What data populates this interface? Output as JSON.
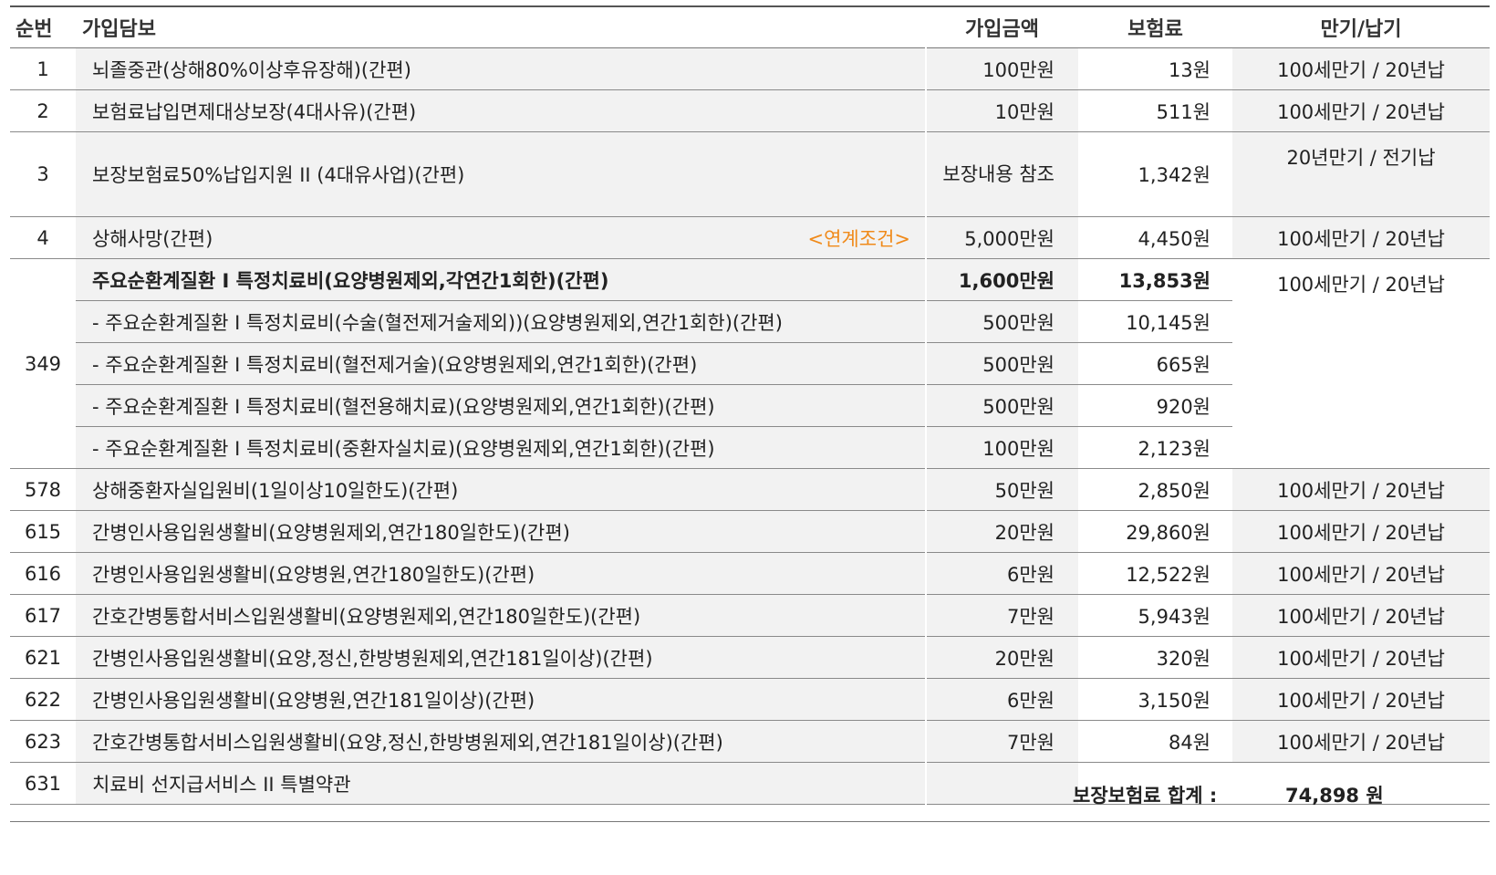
{
  "headers": {
    "no": "순번",
    "name": "가입담보",
    "amount": "가입금액",
    "premium": "보험료",
    "term": "만기/납기"
  },
  "rows": [
    {
      "no": "1",
      "name": "뇌졸중관(상해80%이상후유장해)(간편)",
      "amount": "100만원",
      "premium": "13원",
      "term": "100세만기 / 20년납"
    },
    {
      "no": "2",
      "name": "보험료납입면제대상보장(4대사유)(간편)",
      "amount": "10만원",
      "premium": "511원",
      "term": "100세만기 / 20년납"
    },
    {
      "no": "3",
      "name": "보장보험료50%납입지원 II (4대유사업)(간편)",
      "amount": "보장내용 참조",
      "premium": "1,342원",
      "term": "20년만기 / 전기납"
    },
    {
      "no": "4",
      "name": "상해사망(간편)",
      "link": "<연계조건>",
      "amount": "5,000만원",
      "premium": "4,450원",
      "term": "100세만기 / 20년납"
    }
  ],
  "group": {
    "no": "349",
    "term": "100세만기 / 20년납",
    "main": {
      "name": "주요순환계질환 I  특정치료비(요양병원제외,각연간1회한)(간편)",
      "amount": "1,600만원",
      "premium": "13,853원"
    },
    "subs": [
      {
        "name": "- 주요순환계질환 I 특정치료비(수술(혈전제거술제외))(요양병원제외,연간1회한)(간편)",
        "amount": "500만원",
        "premium": "10,145원"
      },
      {
        "name": "- 주요순환계질환 I 특정치료비(혈전제거술)(요양병원제외,연간1회한)(간편)",
        "amount": "500만원",
        "premium": "665원"
      },
      {
        "name": "- 주요순환계질환 I 특정치료비(혈전용해치료)(요양병원제외,연간1회한)(간편)",
        "amount": "500만원",
        "premium": "920원"
      },
      {
        "name": "- 주요순환계질환 I 특정치료비(중환자실치료)(요양병원제외,연간1회한)(간편)",
        "amount": "100만원",
        "premium": "2,123원"
      }
    ]
  },
  "rows2": [
    {
      "no": "578",
      "name": "상해중환자실입원비(1일이상10일한도)(간편)",
      "amount": "50만원",
      "premium": "2,850원",
      "term": "100세만기 / 20년납"
    },
    {
      "no": "615",
      "name": "간병인사용입원생활비(요양병원제외,연간180일한도)(간편)",
      "amount": "20만원",
      "premium": "29,860원",
      "term": "100세만기 / 20년납"
    },
    {
      "no": "616",
      "name": "간병인사용입원생활비(요양병원,연간180일한도)(간편)",
      "amount": "6만원",
      "premium": "12,522원",
      "term": "100세만기 / 20년납"
    },
    {
      "no": "617",
      "name": "간호간병통합서비스입원생활비(요양병원제외,연간180일한도)(간편)",
      "amount": "7만원",
      "premium": "5,943원",
      "term": "100세만기 / 20년납"
    },
    {
      "no": "621",
      "name": "간병인사용입원생활비(요양,정신,한방병원제외,연간181일이상)(간편)",
      "amount": "20만원",
      "premium": "320원",
      "term": "100세만기 / 20년납"
    },
    {
      "no": "622",
      "name": "간병인사용입원생활비(요양병원,연간181일이상)(간편)",
      "amount": "6만원",
      "premium": "3,150원",
      "term": "100세만기 / 20년납"
    },
    {
      "no": "623",
      "name": "간호간병통합서비스입원생활비(요양,정신,한방병원제외,연간181일이상)(간편)",
      "amount": "7만원",
      "premium": "84원",
      "term": "100세만기 / 20년납"
    },
    {
      "no": "631",
      "name": "치료비 선지급서비스 II  특별약관",
      "amount": "",
      "premium": "",
      "term": ""
    }
  ],
  "total": {
    "label": "보장보험료 합계 :",
    "value": "74,898 원"
  },
  "colors": {
    "link": "#f08a1a",
    "shade": "#f2f2f2"
  }
}
